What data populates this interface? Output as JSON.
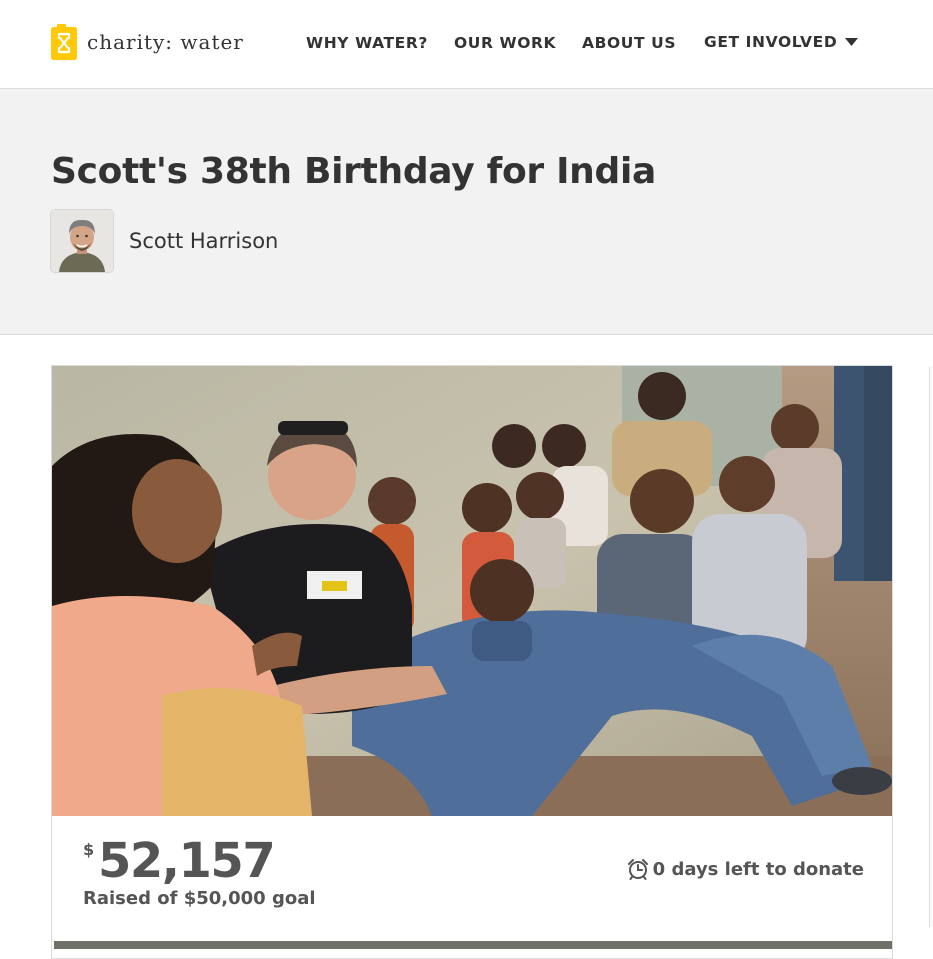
{
  "header": {
    "logo_text": "charity: water",
    "nav": [
      {
        "label": "WHY WATER?"
      },
      {
        "label": "OUR WORK"
      },
      {
        "label": "ABOUT US"
      },
      {
        "label": "GET INVOLVED"
      }
    ]
  },
  "campaign": {
    "title": "Scott's 38th Birthday for India",
    "author": "Scott Harrison",
    "currency_symbol": "$",
    "raised_amount": "52,157",
    "goal_text": "Raised of $50,000 goal",
    "days_left_text": "0 days left to donate",
    "progress_fraction": 1.0
  },
  "colors": {
    "brand_yellow": "#ffc907",
    "page_text": "#333333",
    "stat_text": "#555555",
    "progress_fill": "#6d7168",
    "hero_bg": "#f2f2f2"
  },
  "icons": {
    "logo": "jerrycan-icon",
    "dropdown": "caret-down-icon",
    "timer": "alarm-clock-icon"
  }
}
